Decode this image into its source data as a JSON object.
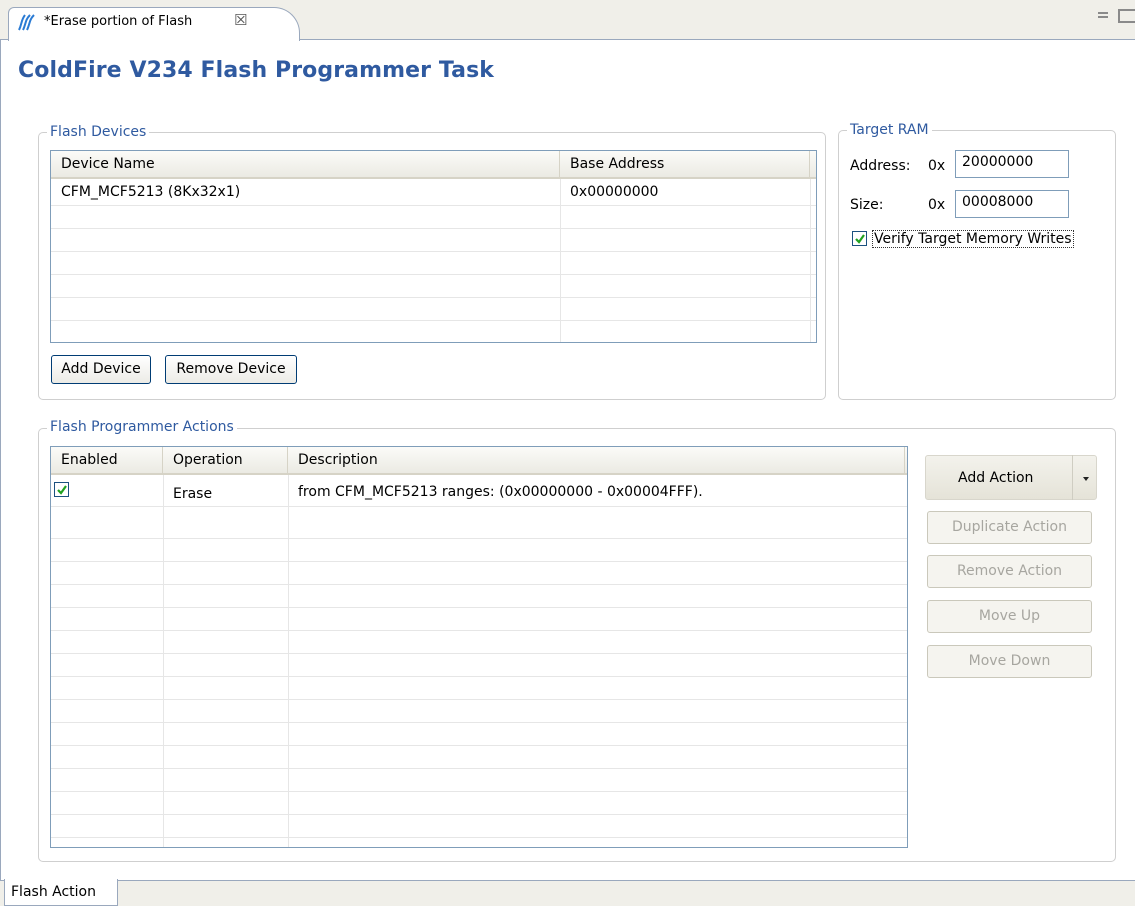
{
  "editor_tab": {
    "title": "*Erase portion of Flash",
    "close_glyph": "☒",
    "icon": "coldfire-task-icon"
  },
  "page_title": "ColdFire V234 Flash Programmer Task",
  "flash_devices": {
    "legend": "Flash Devices",
    "columns": [
      "Device Name",
      "Base Address"
    ],
    "rows": [
      [
        "CFM_MCF5213 (8Kx32x1)",
        "0x00000000"
      ]
    ],
    "add_button": "Add Device",
    "remove_button": "Remove Device"
  },
  "target_ram": {
    "legend": "Target RAM",
    "address_label": "Address:",
    "address_prefix": "0x",
    "address_value": "20000000",
    "size_label": "Size:",
    "size_prefix": "0x",
    "size_value": "00008000",
    "verify_label": "Verify Target Memory Writes",
    "verify_checked": true
  },
  "actions": {
    "legend": "Flash Programmer Actions",
    "columns": [
      "Enabled",
      "Operation",
      "Description"
    ],
    "rows": [
      {
        "enabled": true,
        "operation": "Erase",
        "description": "from CFM_MCF5213 ranges: (0x00000000 - 0x00004FFF)."
      }
    ],
    "add_action": "Add Action",
    "duplicate_action": "Duplicate Action",
    "remove_action": "Remove Action",
    "move_up": "Move Up",
    "move_down": "Move Down"
  },
  "bottom_tab": "Flash Action",
  "colors": {
    "accent": "#2f5aa0",
    "check": "#21a121",
    "border": "#7f9db9"
  }
}
